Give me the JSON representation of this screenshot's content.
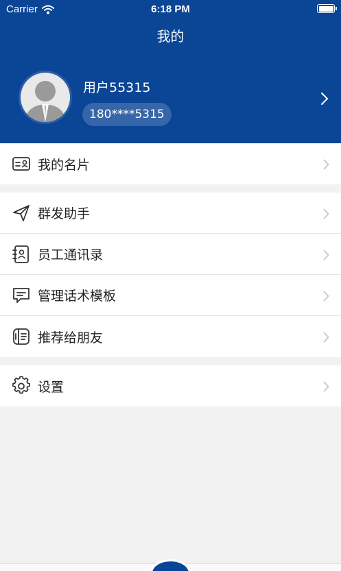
{
  "status_bar": {
    "carrier": "Carrier",
    "time": "6:18 PM"
  },
  "nav": {
    "title": "我的"
  },
  "profile": {
    "name": "用户55315",
    "phone": "180****5315"
  },
  "menu": {
    "card": {
      "label": "我的名片",
      "icon": "card-icon"
    },
    "mass_send": {
      "label": "群发助手",
      "icon": "paper-plane-icon"
    },
    "contacts": {
      "label": "员工通讯录",
      "icon": "contacts-book-icon"
    },
    "scripts": {
      "label": "管理话术模板",
      "icon": "chat-bubble-icon"
    },
    "recommend": {
      "label": "推荐给朋友",
      "icon": "share-card-icon"
    },
    "settings": {
      "label": "设置",
      "icon": "gear-icon"
    }
  },
  "colors": {
    "header": "#0a4596",
    "background": "#f2f2f2",
    "icon": "#333333",
    "chevron": "#c7c7cc"
  }
}
